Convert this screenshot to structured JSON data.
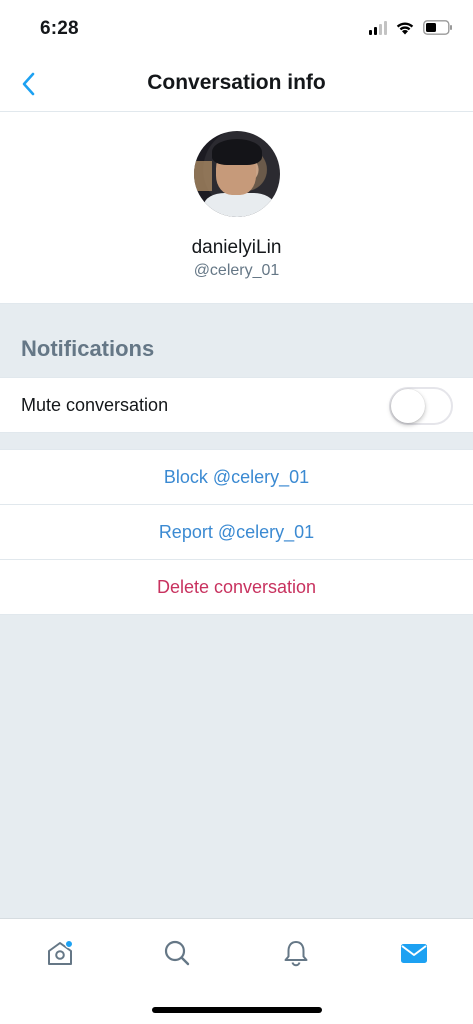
{
  "status_bar": {
    "time": "6:28",
    "icons": [
      "signal-icon",
      "wifi-icon",
      "battery-icon"
    ]
  },
  "nav": {
    "title": "Conversation info",
    "back_icon": "chevron-left-icon"
  },
  "profile": {
    "display_name": "danielyiLin",
    "handle": "@celery_01"
  },
  "notifications": {
    "heading": "Notifications",
    "mute_label": "Mute conversation",
    "mute_on": false
  },
  "actions": [
    {
      "label": "Block @celery_01",
      "color": "#3b8ad2"
    },
    {
      "label": "Report @celery_01",
      "color": "#3b8ad2"
    },
    {
      "label": "Delete conversation",
      "color": "#c8325f"
    }
  ],
  "tab_bar": {
    "tabs": [
      {
        "name": "home",
        "icon": "home-icon",
        "has_badge": true
      },
      {
        "name": "search",
        "icon": "search-icon",
        "has_badge": false
      },
      {
        "name": "notifications",
        "icon": "bell-icon",
        "has_badge": false
      },
      {
        "name": "messages",
        "icon": "mail-icon",
        "active": true
      }
    ]
  },
  "colors": {
    "accent": "#1da1f2",
    "link": "#3b8ad2",
    "destructive": "#c8325f",
    "secondary_text": "#657786",
    "background": "#e6ecf0"
  }
}
